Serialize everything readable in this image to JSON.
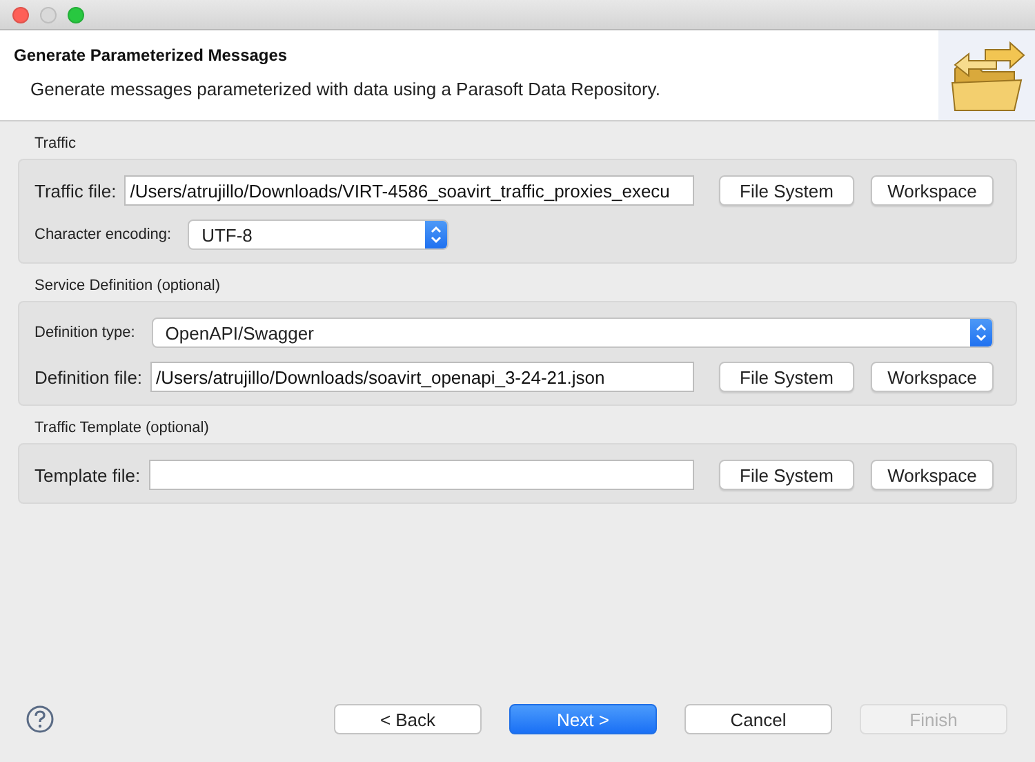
{
  "header": {
    "title": "Generate Parameterized Messages",
    "description": "Generate messages parameterized with data using a Parasoft Data Repository."
  },
  "sections": [
    {
      "title": "Traffic",
      "rows": [
        {
          "kind": "file",
          "label": "Traffic file:",
          "value": "/Users/atrujillo/Downloads/VIRT-4586_soavirt_traffic_proxies_execu",
          "buttons": [
            "File System",
            "Workspace"
          ]
        },
        {
          "kind": "select",
          "label": "Character encoding:",
          "value": "UTF-8",
          "full_width": false
        }
      ]
    },
    {
      "title": "Service Definition (optional)",
      "rows": [
        {
          "kind": "select",
          "label": "Definition type:",
          "value": "OpenAPI/Swagger",
          "full_width": true
        },
        {
          "kind": "file",
          "label": "Definition file:",
          "value": "/Users/atrujillo/Downloads/soavirt_openapi_3-24-21.json",
          "buttons": [
            "File System",
            "Workspace"
          ]
        }
      ]
    },
    {
      "title": "Traffic Template (optional)",
      "rows": [
        {
          "kind": "file",
          "label": "Template file:",
          "value": "",
          "buttons": [
            "File System",
            "Workspace"
          ]
        }
      ]
    }
  ],
  "buttons": [
    {
      "label": "< Back",
      "kind": "default",
      "disabled": false
    },
    {
      "label": "Next >",
      "kind": "primary",
      "disabled": false
    },
    {
      "label": "Cancel",
      "kind": "default",
      "disabled": false
    },
    {
      "label": "Finish",
      "kind": "default",
      "disabled": true
    }
  ]
}
